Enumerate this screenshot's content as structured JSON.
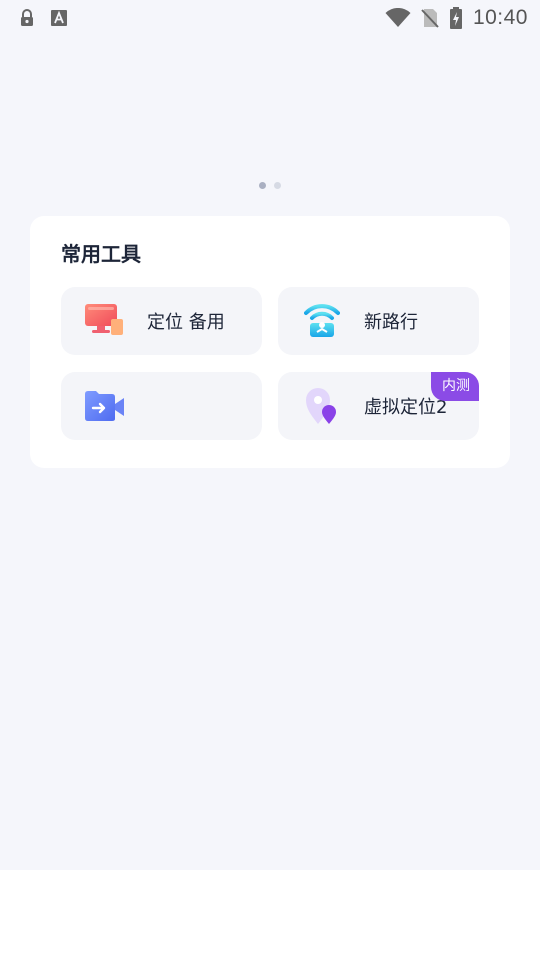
{
  "status_bar": {
    "time": "10:40",
    "left_icons": [
      "lock-icon",
      "keyboard-a-icon"
    ],
    "right_icons": [
      "wifi-icon",
      "no-sim-icon",
      "battery-charging-icon"
    ]
  },
  "carousel": {
    "page_count": 2,
    "active_index": 0
  },
  "tools_card": {
    "title": "常用工具",
    "items": [
      {
        "label": "定位 备用",
        "icon": "monitor-icon"
      },
      {
        "label": "新路行",
        "icon": "wifi-router-icon"
      },
      {
        "label": "",
        "icon": "video-folder-icon"
      },
      {
        "label": "虚拟定位2",
        "icon": "location-pin-icon",
        "badge": "内测"
      }
    ]
  },
  "colors": {
    "background": "#f5f6fb",
    "card": "#ffffff",
    "badge": "#8b4be6",
    "text": "#1d2538"
  }
}
